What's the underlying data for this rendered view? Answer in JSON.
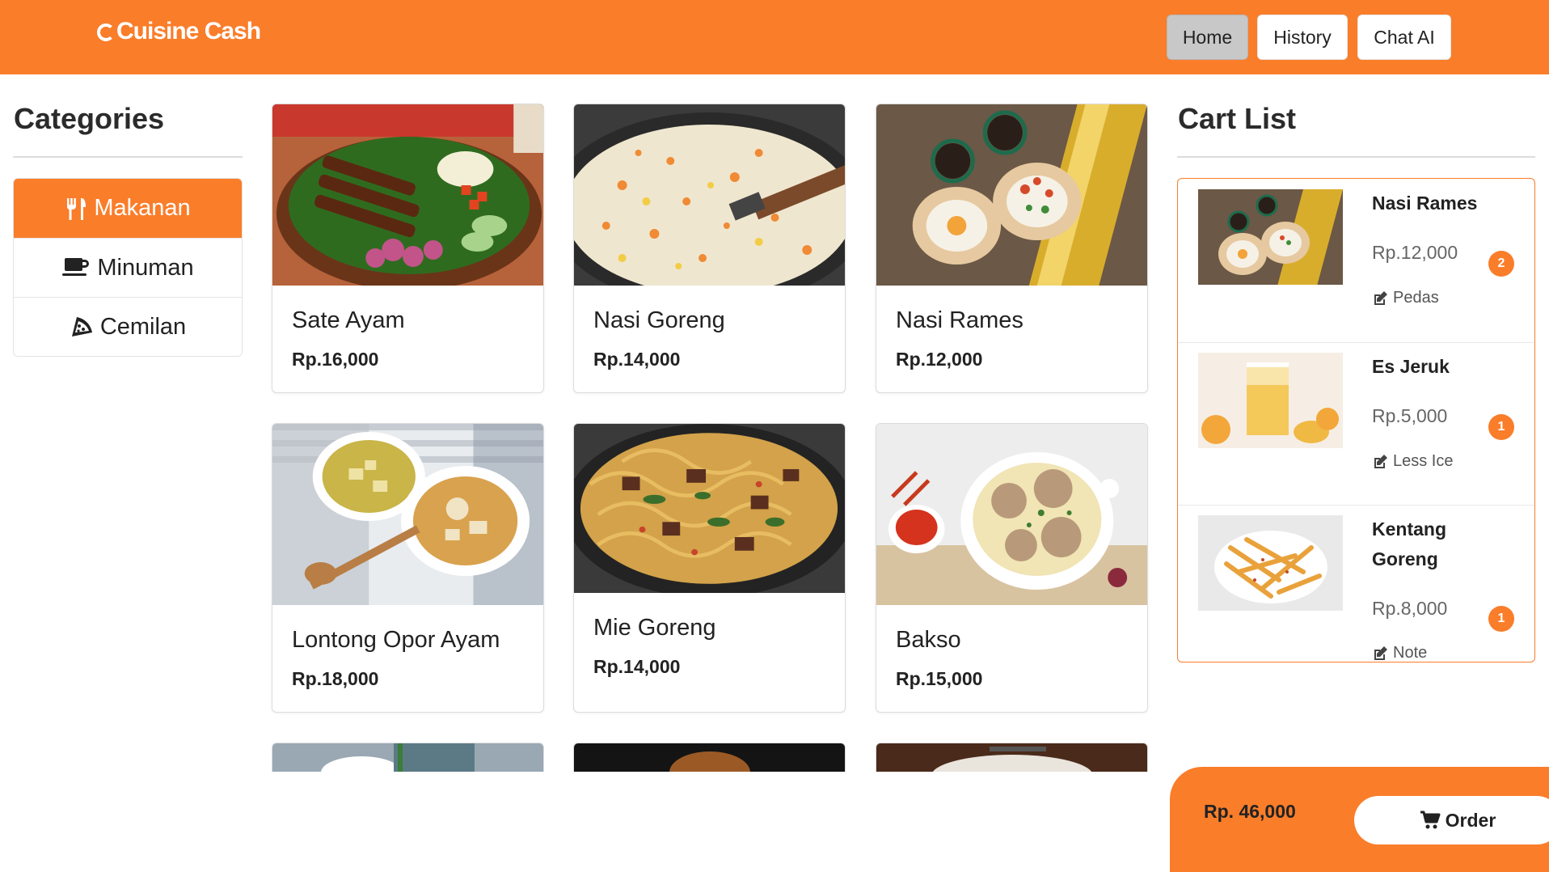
{
  "brand": {
    "name": "Cuisine Cash"
  },
  "nav": {
    "home": "Home",
    "history": "History",
    "chat": "Chat AI"
  },
  "categories": {
    "title": "Categories",
    "items": [
      {
        "label": "Makanan",
        "icon": "utensils-icon",
        "active": true
      },
      {
        "label": "Minuman",
        "icon": "coffee-cup-icon",
        "active": false
      },
      {
        "label": "Cemilan",
        "icon": "pizza-slice-icon",
        "active": false
      }
    ]
  },
  "products": [
    {
      "name": "Sate Ayam",
      "price": "Rp.16,000"
    },
    {
      "name": "Nasi Goreng",
      "price": "Rp.14,000"
    },
    {
      "name": "Nasi Rames",
      "price": "Rp.12,000"
    },
    {
      "name": "Lontong Opor Ayam",
      "price": "Rp.18,000"
    },
    {
      "name": "Mie Goreng",
      "price": "Rp.14,000"
    },
    {
      "name": "Bakso",
      "price": "Rp.15,000"
    }
  ],
  "cart": {
    "title": "Cart List",
    "items": [
      {
        "name": "Nasi Rames",
        "price": "Rp.12,000",
        "note": "Pedas",
        "qty": "2"
      },
      {
        "name": "Es Jeruk",
        "price": "Rp.5,000",
        "note": "Less Ice",
        "qty": "1"
      },
      {
        "name": "Kentang Goreng",
        "price": "Rp.8,000",
        "note": "Note",
        "qty": "1"
      }
    ]
  },
  "order": {
    "total": "Rp. 46,000",
    "button": "Order"
  },
  "colors": {
    "accent": "#fa7d2a",
    "active_nav": "#c8c8c8"
  }
}
